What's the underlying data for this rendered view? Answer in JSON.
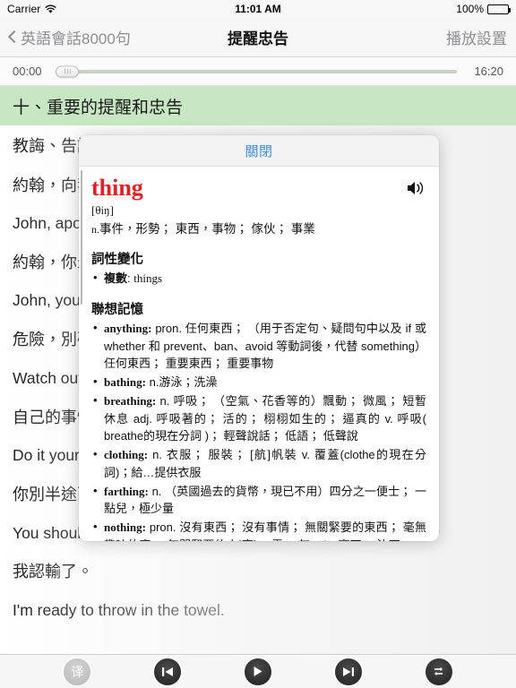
{
  "status_bar": {
    "carrier": "Carrier",
    "wifi_icon": "wifi-icon",
    "time": "11:01 AM",
    "battery_percent": "100%",
    "battery_icon": "battery-full-icon"
  },
  "nav_bar": {
    "back_icon": "chevron-left-icon",
    "back_label": "英語會話8000句",
    "title": "提醒忠告",
    "right_label": "播放設置"
  },
  "player": {
    "elapsed": "00:00",
    "duration": "16:20",
    "progress_percent": 0
  },
  "section": {
    "header": "十、重要的提醒和忠告"
  },
  "content": {
    "lines": [
      {
        "text": "教誨、告誡",
        "lang": "zh"
      },
      {
        "text": "約翰，向我道歉！",
        "lang": "zh"
      },
      {
        "text": "John, apologize to me!",
        "lang": "en"
      },
      {
        "text": "約翰，你最好當心點。",
        "lang": "zh"
      },
      {
        "text": "John, you'd better watch out.",
        "lang": "en"
      },
      {
        "text": "危險，別碰！",
        "lang": "zh"
      },
      {
        "text": "Watch out! Don't touch it!",
        "lang": "en"
      },
      {
        "text": "自己的事情自己做。",
        "lang": "zh"
      },
      {
        "text": "Do it yourself.",
        "lang": "en"
      },
      {
        "text": "你別半途而廢。",
        "lang": "zh"
      },
      {
        "text": "You should finish what you start.",
        "lang": "en"
      },
      {
        "text": "我認輸了。",
        "lang": "zh"
      },
      {
        "text": "I'm ready to throw in the towel.",
        "lang": "en"
      }
    ]
  },
  "popup": {
    "close_label": "關閉",
    "headword": "thing",
    "speaker_icon": "speaker-icon",
    "phonetic": "[θiŋ]",
    "sense_pos": "n.",
    "sense_text": "事件，形勢；  東西，事物；  傢伙；  事業",
    "inflection_title": "詞性變化",
    "inflections": [
      {
        "label": "複數",
        "value": "things"
      }
    ],
    "association_title": "聯想記憶",
    "associations": [
      {
        "word": "anything:",
        "def": "pron. 任何東西；  （用于否定句、疑問句中以及 if 或 whether 和 prevent、ban、avoid 等動詞後，代替 something） 任何東西；  重要東西；  重要事物"
      },
      {
        "word": "bathing:",
        "def": "n.游泳；洗澡"
      },
      {
        "word": "breathing:",
        "def": "n. 呼吸；  （空氣、花香等的）飄動；  微風；  短暫休息 adj. 呼吸著的；  活的；  栩栩如生的；  逼真的 v. 呼吸( breathe的現在分詞 )；  輕聲說話；  低語；  低聲說"
      },
      {
        "word": "clothing:",
        "def": "n. 衣服；  服裝；  [航]帆裝 v. 覆蓋(clothe的現在分詞)；給…提供衣服"
      },
      {
        "word": "farthing:",
        "def": "n. （英國過去的貨幣，現已不用）四分之一便士；  一點兒，極少量"
      },
      {
        "word": "nothing:",
        "def": "pron. 沒有東西；  沒有事情；  無關緊要的東西；  毫無趣味的事 n. 無關緊要的人[事]；  零；  無 adv. 毫不；  決不 neg. 沒"
      }
    ]
  },
  "toolbar": {
    "buttons": [
      {
        "name": "translate-button",
        "icon": "translate-icon",
        "label": "译",
        "disabled": true
      },
      {
        "name": "previous-button",
        "icon": "skip-previous-icon",
        "label": "",
        "disabled": false
      },
      {
        "name": "play-button",
        "icon": "play-icon",
        "label": "",
        "disabled": false
      },
      {
        "name": "next-button",
        "icon": "skip-next-icon",
        "label": "",
        "disabled": false
      },
      {
        "name": "repeat-button",
        "icon": "repeat-icon",
        "label": "",
        "disabled": false
      }
    ]
  },
  "colors": {
    "accent_link": "#3b8bf5",
    "headword_red": "#ee1b20",
    "section_green": "#c7e6c2",
    "nav_gray": "#8e8e93"
  }
}
